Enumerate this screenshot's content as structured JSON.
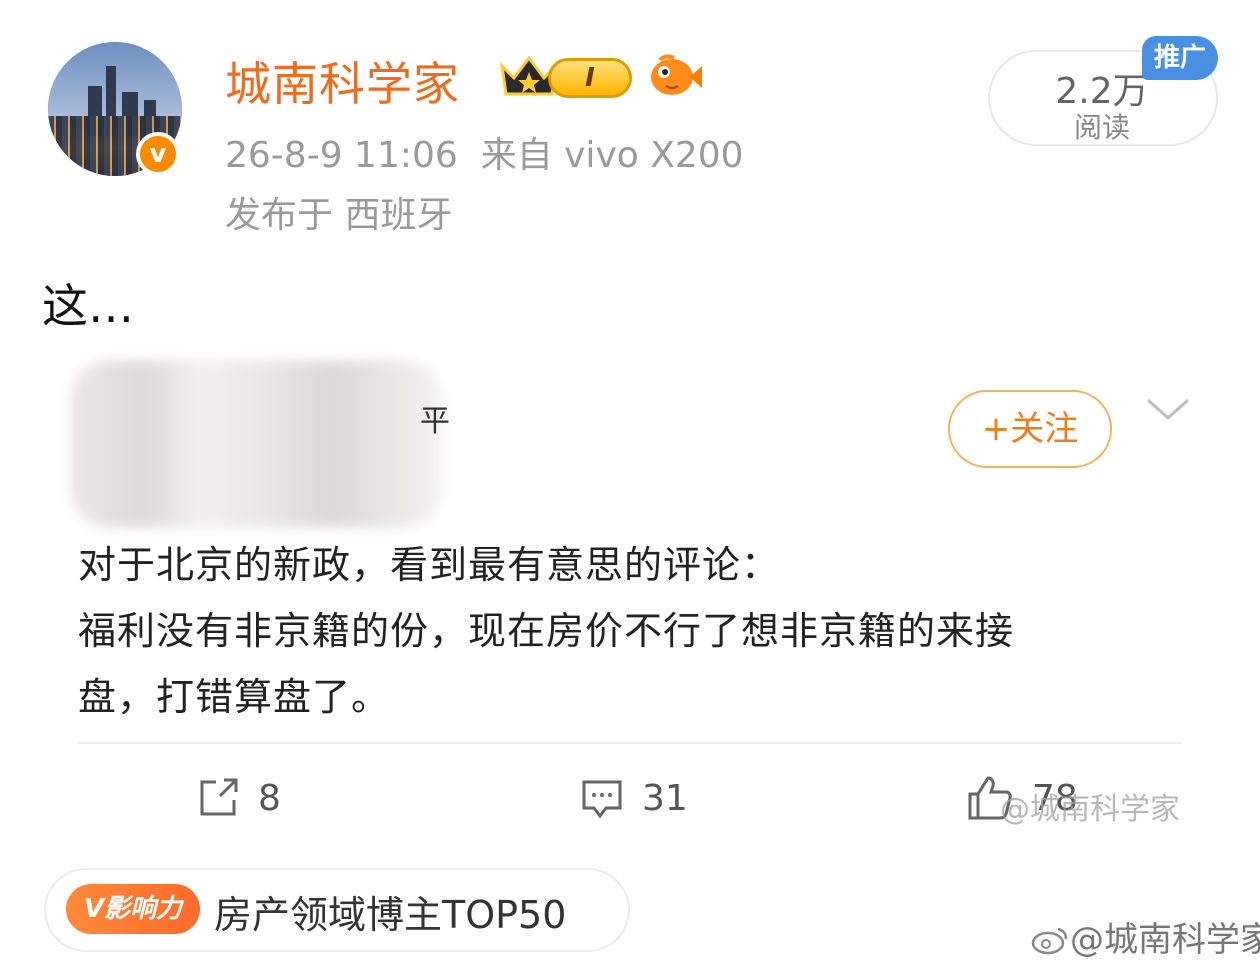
{
  "post": {
    "author": "城南科学家",
    "level": "I",
    "verified_mark": "v",
    "timestamp": "26-8-9 11:06",
    "source": "来自 vivo X200",
    "location": "发布于 西班牙",
    "views_count": "2.2万",
    "views_label": "阅读",
    "promo_label": "推广",
    "text": "这…"
  },
  "quoted": {
    "follow_label": "+关注",
    "blur_hint": "平",
    "lines": [
      "对于北京的新政，看到最有意思的评论：",
      "福利没有非京籍的份，现在房价不行了想非京籍的来接",
      "盘，打错算盘了。"
    ]
  },
  "actions": {
    "repost_count": "8",
    "comment_count": "31",
    "like_count": "78"
  },
  "influence": {
    "badge": "V影响力",
    "text": "房产领域博主TOP50"
  },
  "watermark_mid": "@城南科学家",
  "watermark": "@城南科学家",
  "colors": {
    "accent": "#f26a1b",
    "promo": "#4a90e2"
  }
}
